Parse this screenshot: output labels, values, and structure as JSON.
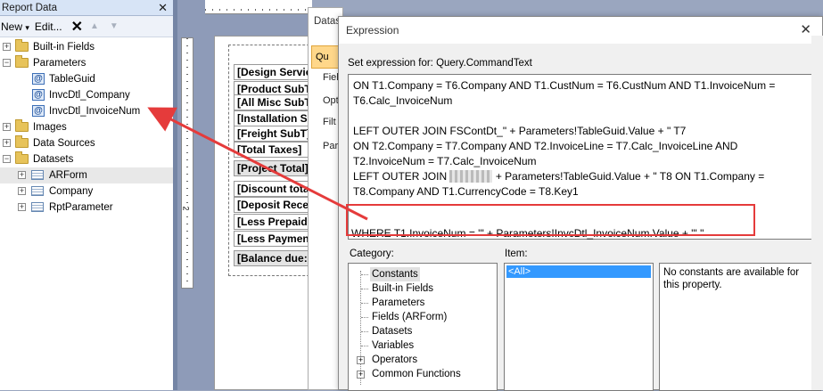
{
  "left_panel": {
    "title": "Report Data",
    "close": "✕",
    "toolbar": {
      "new": "New",
      "new_caret": "▾",
      "edit": "Edit...",
      "delete": "✕",
      "up": "▲",
      "down": "▼"
    },
    "tree": [
      {
        "label": "Built-in Fields",
        "kind": "folder",
        "expander": "+"
      },
      {
        "label": "Parameters",
        "kind": "folder-open",
        "expander": "−"
      },
      {
        "label": "TableGuid",
        "kind": "param"
      },
      {
        "label": "InvcDtl_Company",
        "kind": "param"
      },
      {
        "label": "InvcDtl_InvoiceNum",
        "kind": "param"
      },
      {
        "label": "Images",
        "kind": "folder",
        "expander": "+"
      },
      {
        "label": "Data Sources",
        "kind": "folder",
        "expander": "+"
      },
      {
        "label": "Datasets",
        "kind": "folder-open",
        "expander": "−"
      },
      {
        "label": "ARForm",
        "kind": "table",
        "expander": "+"
      },
      {
        "label": "Company",
        "kind": "table",
        "expander": "+"
      },
      {
        "label": "RptParameter",
        "kind": "table",
        "expander": "+"
      }
    ]
  },
  "designer": {
    "ruler_mark": "2",
    "fields": [
      {
        "text": "[Design Servic",
        "shade": false
      },
      {
        "text": "[Product SubT",
        "shade": false
      },
      {
        "text": "[All Misc SubT",
        "shade": false
      },
      {
        "text": "[Installation S",
        "shade": false
      },
      {
        "text": "[Freight SubT]",
        "shade": false
      },
      {
        "text": "[Total Taxes]",
        "shade": false
      },
      {
        "text": "[Project Total]",
        "shade": true
      },
      {
        "text": "[Discount tota",
        "shade": false
      },
      {
        "text": "[Deposit Rece",
        "shade": false
      },
      {
        "text": "[Less Prepaid",
        "shade": false
      },
      {
        "text": "[Less Paymen",
        "shade": false
      },
      {
        "text": "[Balance due:",
        "shade": true
      }
    ]
  },
  "dataset_dialog": {
    "title": "Datas",
    "tabs": [
      "Qu",
      "Fiel",
      "Opt",
      "Filt",
      "Par"
    ]
  },
  "expression_dialog": {
    "title": "Expression",
    "close": "✕",
    "set_label": "Set expression for: Query.CommandText",
    "lines": [
      "ON T1.Company = T6.Company AND T1.CustNum = T6.CustNum AND T1.InvoiceNum =",
      "T6.Calc_InvoiceNum",
      "",
      "LEFT OUTER JOIN FSContDt_\" + Parameters!TableGuid.Value + \" T7",
      "ON T2.Company = T7.Company AND T2.InvoiceLine = T7.Calc_InvoiceLine AND",
      "T2.InvoiceNum = T7.Calc_InvoiceNum",
      "LEFT OUTER JOIN",
      "+ Parameters!TableGuid.Value + \" T8 ON T1.Company =",
      "T8.Company AND T1.CurrencyCode = T8.Key1"
    ],
    "where_line": "WHERE T1.InvoiceNum = '\" + Parameters!InvcDtl_InvoiceNum.Value + \"' \"",
    "category_label": "Category:",
    "item_label": "Item:",
    "categories": [
      {
        "label": "Constants",
        "selected": true,
        "expander": ""
      },
      {
        "label": "Built-in Fields",
        "selected": false,
        "expander": ""
      },
      {
        "label": "Parameters",
        "selected": false,
        "expander": ""
      },
      {
        "label": "Fields (ARForm)",
        "selected": false,
        "expander": ""
      },
      {
        "label": "Datasets",
        "selected": false,
        "expander": ""
      },
      {
        "label": "Variables",
        "selected": false,
        "expander": ""
      },
      {
        "label": "Operators",
        "selected": false,
        "expander": "+"
      },
      {
        "label": "Common Functions",
        "selected": false,
        "expander": "+"
      }
    ],
    "items": [
      "<All>"
    ],
    "description": "No constants are available for this property."
  },
  "colors": {
    "highlight": "#e53b3b",
    "selection": "#3399ff"
  }
}
